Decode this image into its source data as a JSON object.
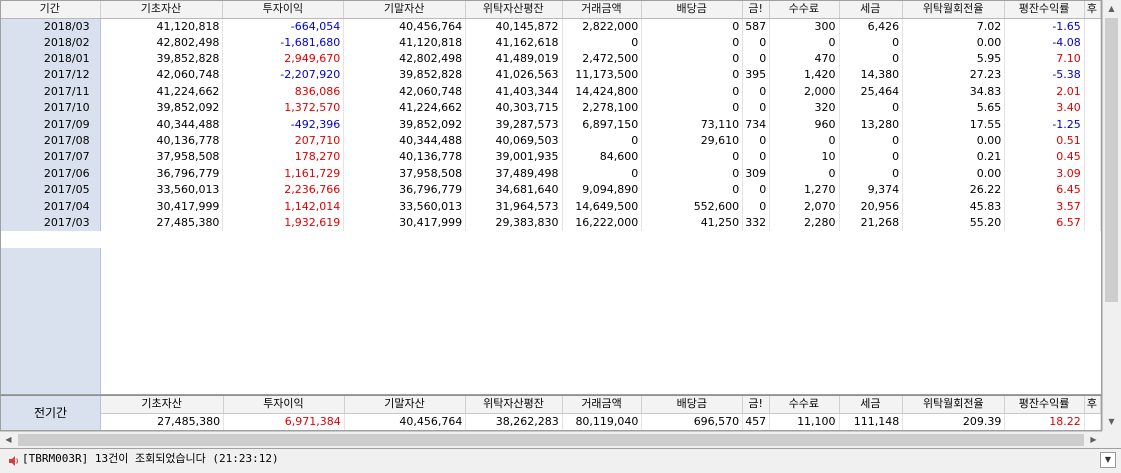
{
  "grid": {
    "columns": [
      "기간",
      "기초자산",
      "투자이익",
      "기말자산",
      "위탁자산평잔",
      "거래금액",
      "배당금",
      "금!",
      "수수료",
      "세금",
      "위탁월회전율",
      "평잔수익률",
      "후"
    ],
    "rows": [
      {
        "period": "2018/03",
        "base": "41,120,818",
        "profit": "-664,054",
        "end": "40,456,764",
        "avg": "40,145,872",
        "trade": "2,822,000",
        "div": "0",
        "cut": "587",
        "fee": "300",
        "tax": "6,426",
        "turnover": "7.02",
        "yield": "-1.65"
      },
      {
        "period": "2018/02",
        "base": "42,802,498",
        "profit": "-1,681,680",
        "end": "41,120,818",
        "avg": "41,162,618",
        "trade": "0",
        "div": "0",
        "cut": "0",
        "fee": "0",
        "tax": "0",
        "turnover": "0.00",
        "yield": "-4.08"
      },
      {
        "period": "2018/01",
        "base": "39,852,828",
        "profit": "2,949,670",
        "end": "42,802,498",
        "avg": "41,489,019",
        "trade": "2,472,500",
        "div": "0",
        "cut": "0",
        "fee": "470",
        "tax": "0",
        "turnover": "5.95",
        "yield": "7.10"
      },
      {
        "period": "2017/12",
        "base": "42,060,748",
        "profit": "-2,207,920",
        "end": "39,852,828",
        "avg": "41,026,563",
        "trade": "11,173,500",
        "div": "0",
        "cut": "395",
        "fee": "1,420",
        "tax": "14,380",
        "turnover": "27.23",
        "yield": "-5.38"
      },
      {
        "period": "2017/11",
        "base": "41,224,662",
        "profit": "836,086",
        "end": "42,060,748",
        "avg": "41,403,344",
        "trade": "14,424,800",
        "div": "0",
        "cut": "0",
        "fee": "2,000",
        "tax": "25,464",
        "turnover": "34.83",
        "yield": "2.01"
      },
      {
        "period": "2017/10",
        "base": "39,852,092",
        "profit": "1,372,570",
        "end": "41,224,662",
        "avg": "40,303,715",
        "trade": "2,278,100",
        "div": "0",
        "cut": "0",
        "fee": "320",
        "tax": "0",
        "turnover": "5.65",
        "yield": "3.40"
      },
      {
        "period": "2017/09",
        "base": "40,344,488",
        "profit": "-492,396",
        "end": "39,852,092",
        "avg": "39,287,573",
        "trade": "6,897,150",
        "div": "73,110",
        "cut": "734",
        "fee": "960",
        "tax": "13,280",
        "turnover": "17.55",
        "yield": "-1.25"
      },
      {
        "period": "2017/08",
        "base": "40,136,778",
        "profit": "207,710",
        "end": "40,344,488",
        "avg": "40,069,503",
        "trade": "0",
        "div": "29,610",
        "cut": "0",
        "fee": "0",
        "tax": "0",
        "turnover": "0.00",
        "yield": "0.51"
      },
      {
        "period": "2017/07",
        "base": "37,958,508",
        "profit": "178,270",
        "end": "40,136,778",
        "avg": "39,001,935",
        "trade": "84,600",
        "div": "0",
        "cut": "0",
        "fee": "10",
        "tax": "0",
        "turnover": "0.21",
        "yield": "0.45"
      },
      {
        "period": "2017/06",
        "base": "36,796,779",
        "profit": "1,161,729",
        "end": "37,958,508",
        "avg": "37,489,498",
        "trade": "0",
        "div": "0",
        "cut": "309",
        "fee": "0",
        "tax": "0",
        "turnover": "0.00",
        "yield": "3.09"
      },
      {
        "period": "2017/05",
        "base": "33,560,013",
        "profit": "2,236,766",
        "end": "36,796,779",
        "avg": "34,681,640",
        "trade": "9,094,890",
        "div": "0",
        "cut": "0",
        "fee": "1,270",
        "tax": "9,374",
        "turnover": "26.22",
        "yield": "6.45"
      },
      {
        "period": "2017/04",
        "base": "30,417,999",
        "profit": "1,142,014",
        "end": "33,560,013",
        "avg": "31,964,573",
        "trade": "14,649,500",
        "div": "552,600",
        "cut": "0",
        "fee": "2,070",
        "tax": "20,956",
        "turnover": "45.83",
        "yield": "3.57"
      },
      {
        "period": "2017/03",
        "base": "27,485,380",
        "profit": "1,932,619",
        "end": "30,417,999",
        "avg": "29,383,830",
        "trade": "16,222,000",
        "div": "41,250",
        "cut": "332",
        "fee": "2,280",
        "tax": "21,268",
        "turnover": "55.20",
        "yield": "6.57"
      }
    ]
  },
  "total": {
    "label": "전기간",
    "columns": [
      "기초자산",
      "투자이익",
      "기말자산",
      "위탁자산평잔",
      "거래금액",
      "배당금",
      "금!",
      "수수료",
      "세금",
      "위탁월회전율",
      "평잔수익률",
      "후"
    ],
    "values": [
      "27,485,380",
      "6,971,384",
      "40,456,764",
      "38,262,283",
      "80,119,040",
      "696,570",
      "457",
      "11,100",
      "111,148",
      "209.39",
      "18.22",
      ""
    ]
  },
  "status": {
    "message": "[TBRM003R] 13건이 조회되었습니다 (21:23:12)",
    "icon": "speaker-icon"
  },
  "colors": {
    "positive": "#e00000",
    "negative": "#0000d0",
    "row_header_bg": "#dae1ee"
  }
}
